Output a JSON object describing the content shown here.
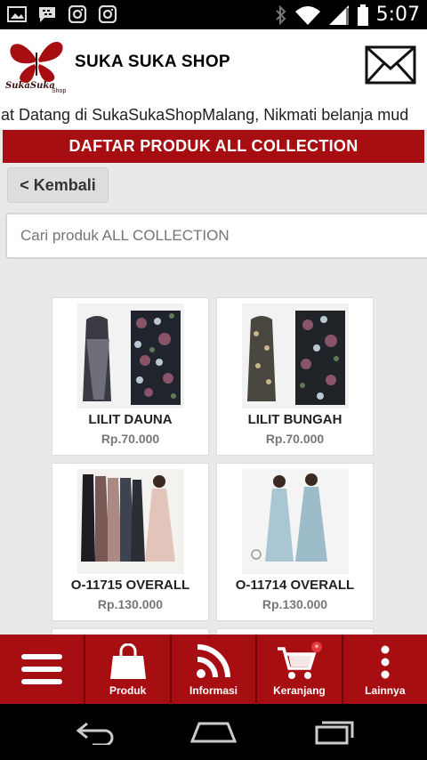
{
  "status_bar": {
    "time": "5:07",
    "left_icons": [
      "gallery-icon",
      "bbm-icon",
      "instagram-icon",
      "instagram-icon"
    ],
    "right_icons": [
      "bluetooth-icon",
      "wifi-icon",
      "signal-icon",
      "battery-icon"
    ]
  },
  "header": {
    "logo_text": "SukaSuka",
    "logo_subtext": "Shop",
    "title": "SUKA SUKA SHOP",
    "mail_icon": "mail-icon"
  },
  "marquee": {
    "text": "hat Datang di SukaSukaShopMalang, Nikmati belanja mud"
  },
  "section": {
    "title": "DAFTAR PRODUK ALL COLLECTION",
    "back_label": "< Kembali",
    "search_placeholder": "Cari produk ALL COLLECTION"
  },
  "products": [
    {
      "name": "LILIT DAUNA",
      "price": "Rp.70.000"
    },
    {
      "name": "LILIT BUNGAH",
      "price": "Rp.70.000"
    },
    {
      "name": "O-11715 OVERALL",
      "price": "Rp.130.000"
    },
    {
      "name": "O-11714 OVERALL",
      "price": "Rp.130.000"
    }
  ],
  "bottom_nav": [
    {
      "label": "",
      "icon": "menu-icon"
    },
    {
      "label": "Produk",
      "icon": "shopping-bag-icon"
    },
    {
      "label": "Informasi",
      "icon": "rss-icon"
    },
    {
      "label": "Keranjang",
      "icon": "cart-icon",
      "badge": "*"
    },
    {
      "label": "Lainnya",
      "icon": "more-vertical-icon"
    }
  ],
  "colors": {
    "accent": "#a60e12",
    "background": "#e9e9e9"
  }
}
